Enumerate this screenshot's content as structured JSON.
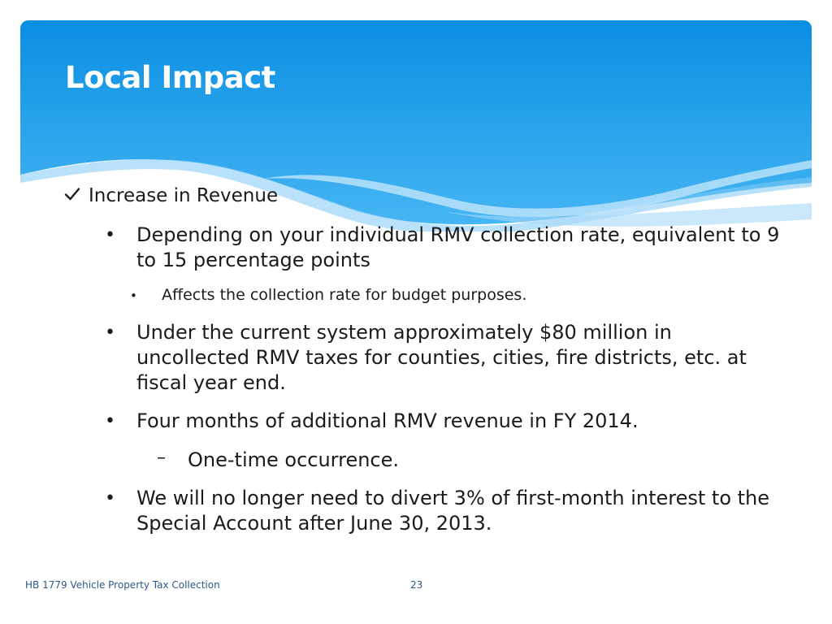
{
  "slide": {
    "title": "Local Impact",
    "heading": "Increase in Revenue",
    "bullet1": {
      "line1": "Depending on your individual RMV collection rate, equivalent to 9",
      "line2": "to 15 percentage points"
    },
    "sub_bullet": "Affects the collection rate for budget purposes.",
    "bullet2": {
      "line1": "Under the current system approximately $80 million in",
      "line2": "uncollected RMV taxes for counties, cities, fire districts, etc. at",
      "line3": "fiscal year end."
    },
    "bullet3": "Four months of additional RMV revenue in FY 2014.",
    "dash_item": "One-time occurrence.",
    "bullet4": {
      "line1": "We will no longer need to divert 3% of first-month interest to the",
      "line2": "Special Account after June 30, 2013."
    }
  },
  "footer": {
    "left_text": "HB 1779 Vehicle Property Tax Collection",
    "page_number": "23"
  },
  "colors": {
    "header_top": "#0f8fe0",
    "header_bottom": "#3fb2f2",
    "footer_text": "#2d5a8a"
  },
  "icons": {
    "check": "checkmark-icon",
    "bullet": "bullet-dot",
    "dash": "en-dash"
  }
}
